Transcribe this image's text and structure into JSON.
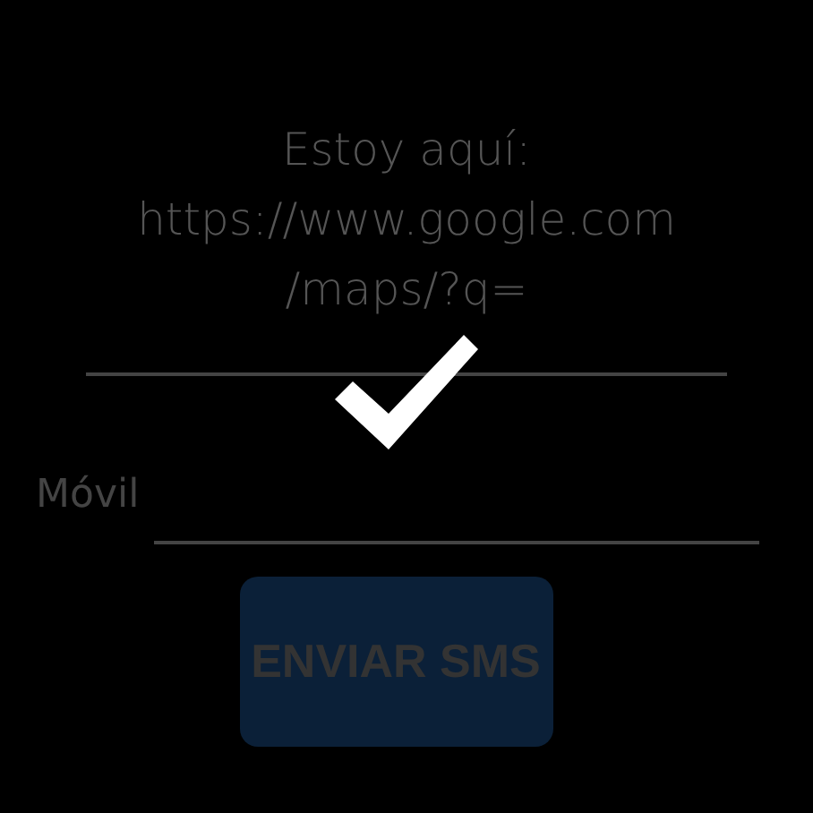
{
  "message": {
    "lines": [
      "Estoy aquí:",
      "https://www.google.com",
      "/maps/?q="
    ]
  },
  "confirmation": {
    "shown": true
  },
  "phone": {
    "label": "Móvil"
  },
  "send_button": {
    "label": "ENVIAR SMS",
    "disabled": true
  }
}
